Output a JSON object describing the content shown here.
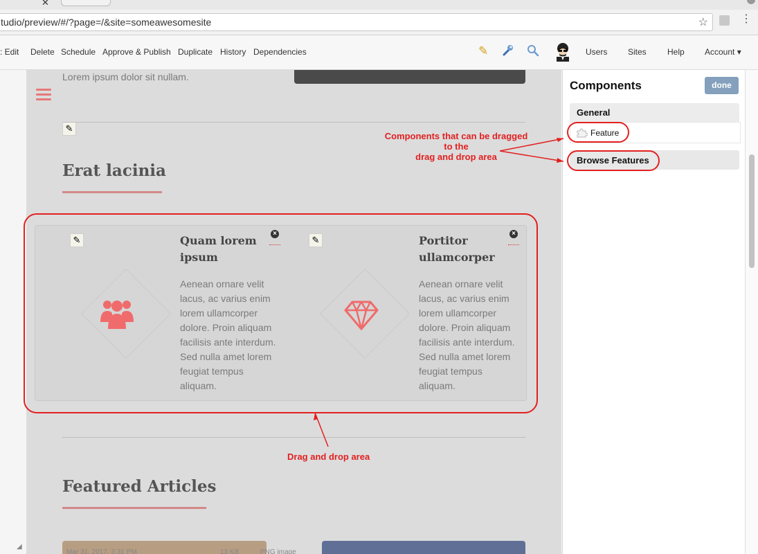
{
  "browser": {
    "url": "tudio/preview/#/?page=/&site=someawesomesite",
    "tab_close": "✕"
  },
  "toolbar": {
    "left_items": [
      ": Edit",
      "Delete",
      "Schedule",
      "Approve & Publish",
      "Duplicate",
      "History",
      "Dependencies"
    ],
    "right_items": [
      "Users",
      "Sites",
      "Help",
      "Account ▾"
    ],
    "icons": [
      "pencil-icon",
      "wrench-icon",
      "search-icon",
      "avatar"
    ]
  },
  "page": {
    "intro_text": "Lorem ipsum dolor sit nullam.",
    "section1_title": "Erat lacinia",
    "features": [
      {
        "title": "Quam lorem ipsum",
        "body": "Aenean ornare velit lacus, ac varius enim lorem ullamcorper dolore. Proin aliquam facilisis ante interdum. Sed nulla amet lorem feugiat tempus aliquam.",
        "icon": "users-icon",
        "icon_color": "#f06b6b"
      },
      {
        "title": "Portitor ullamcorper",
        "body": "Aenean ornare velit lacus, ac varius enim lorem ullamcorper dolore. Proin aliquam facilisis ante interdum. Sed nulla amet lorem feugiat tempus aliquam.",
        "icon": "diamond-icon",
        "icon_color": "#f06b6b"
      }
    ],
    "section2_title": "Featured Articles",
    "article_caption": "Mar 31, 2017, 3:31 PM",
    "article_size": "13 KB",
    "article_type": "PNG image"
  },
  "components_panel": {
    "title": "Components",
    "done_label": "done",
    "group_label": "General",
    "component_label": "Feature",
    "browse_label": "Browse Features"
  },
  "annotations": {
    "components_note_line1": "Components that can be dragged",
    "components_note_line2": "to the",
    "components_note_line3": "drag and drop area",
    "drop_note": "Drag and drop area",
    "color": "#e32020"
  },
  "colors": {
    "accent_red": "#f06b6b",
    "done_button": "#84a0bc"
  }
}
